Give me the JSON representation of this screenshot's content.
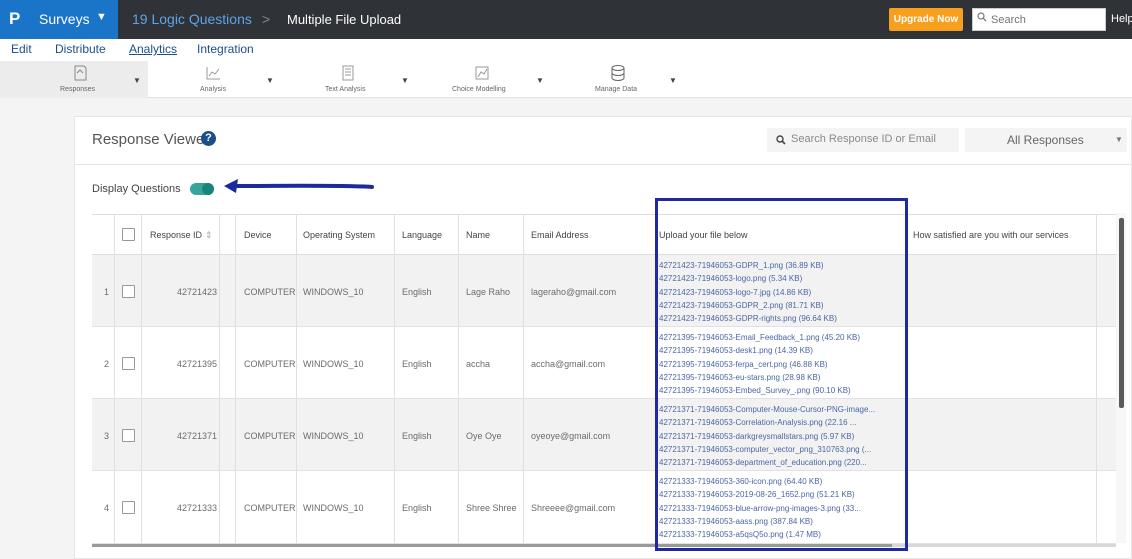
{
  "topbar": {
    "logo": "P",
    "app_name": "Surveys",
    "breadcrumb_survey": "19 Logic Questions",
    "breadcrumb_sep": ">",
    "breadcrumb_page": "Multiple File Upload",
    "upgrade_label": "Upgrade Now",
    "search_placeholder": "Search",
    "help_label": "Help"
  },
  "nav": {
    "items": [
      "Edit",
      "Distribute",
      "Analytics",
      "Integration"
    ],
    "active": "Analytics"
  },
  "toolbar": {
    "items": [
      {
        "label": "Responses",
        "icon": "responses-icon"
      },
      {
        "label": "Analysis",
        "icon": "analysis-icon"
      },
      {
        "label": "Text Analysis",
        "icon": "text-analysis-icon"
      },
      {
        "label": "Choice Modelling",
        "icon": "choice-modelling-icon"
      },
      {
        "label": "Manage Data",
        "icon": "database-icon"
      }
    ]
  },
  "viewer": {
    "title": "Response Viewer",
    "help_glyph": "?",
    "search_placeholder": "Search Response ID or Email",
    "filter_value": "All Responses",
    "display_questions_label": "Display Questions",
    "display_questions_on": true
  },
  "table": {
    "headers": {
      "response_id": "Response ID",
      "sort_glyph": "⇕",
      "device": "Device",
      "os": "Operating System",
      "language": "Language",
      "name": "Name",
      "email": "Email Address",
      "upload": "Upload your file below",
      "satisfaction": "How satisfied are you with our services"
    },
    "rows": [
      {
        "num": "1",
        "id": "42721423",
        "device": "COMPUTER",
        "os": "WINDOWS_10",
        "language": "English",
        "name": "Lage Raho",
        "email": "lageraho@gmail.com",
        "files": [
          "42721423-71946053-GDPR_1.png (36.89 KB)",
          "42721423-71946053-logo.png (5.34 KB)",
          "42721423-71946053-logo-7.jpg (14.86 KB)",
          "42721423-71946053-GDPR_2.png (81.71 KB)",
          "42721423-71946053-GDPR-rights.png (96.64 KB)"
        ]
      },
      {
        "num": "2",
        "id": "42721395",
        "device": "COMPUTER",
        "os": "WINDOWS_10",
        "language": "English",
        "name": "accha",
        "email": "accha@gmail.com",
        "files": [
          "42721395-71946053-Email_Feedback_1.png (45.20 KB)",
          "42721395-71946053-desk1.png (14.39 KB)",
          "42721395-71946053-ferpa_cert.png (46.88 KB)",
          "42721395-71946053-eu-stars.png (28.98 KB)",
          "42721395-71946053-Embed_Survey_.png (90.10 KB)"
        ]
      },
      {
        "num": "3",
        "id": "42721371",
        "device": "COMPUTER",
        "os": "WINDOWS_10",
        "language": "English",
        "name": "Oye Oye",
        "email": "oyeoye@gmail.com",
        "files": [
          "42721371-71946053-Computer-Mouse-Cursor-PNG-image...",
          "42721371-71946053-Correlation-Analysis.png (22.16 ...",
          "42721371-71946053-darkgreysmallstars.png (5.97 KB)",
          "42721371-71946053-computer_vector_png_310763.png (...",
          "42721371-71946053-department_of_education.png (220..."
        ]
      },
      {
        "num": "4",
        "id": "42721333",
        "device": "COMPUTER",
        "os": "WINDOWS_10",
        "language": "English",
        "name": "Shree Shree",
        "email": "Shreeee@gmail.com",
        "files": [
          "42721333-71946053-360-icon.png (64.40 KB)",
          "42721333-71946053-2019-08-26_1652.png (51.21 KB)",
          "42721333-71946053-blue-arrow-png-images-3.png (33...",
          "42721333-71946053-aass.png (387.84 KB)",
          "42721333-71946053-a5qsQ5o.png (1.47 MB)"
        ]
      }
    ]
  },
  "colors": {
    "topbar_bg": "#2f3237",
    "brand_blue": "#1a74c8",
    "upgrade_orange": "#f7a01d",
    "toggle_teal": "#37a59a",
    "highlight_box": "#1f2aa0",
    "file_link": "#4a67a3"
  }
}
